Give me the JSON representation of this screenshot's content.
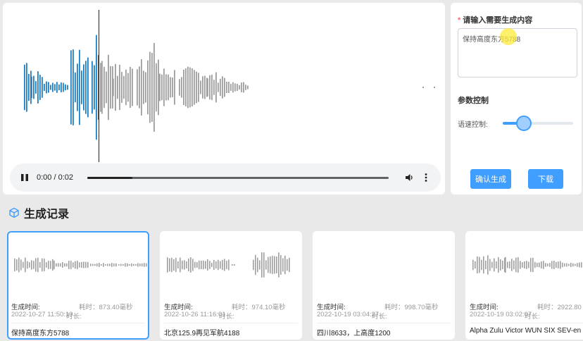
{
  "player": {
    "time": "0:00 / 0:02",
    "progress": 0.15
  },
  "form": {
    "content_label": "请输入需要生成内容",
    "required_mark": "*",
    "content_value": "保持高度东方5788",
    "params_title": "参数控制",
    "speed_label": "语速控制:",
    "speed_value": 0.3,
    "confirm_label": "确认生成",
    "download_label": "下载"
  },
  "history": {
    "title": "生成记录",
    "items": [
      {
        "gen_label": "生成时间:",
        "duration": "耗时：873.40毫秒",
        "time": "2022-10-27 11:50:19",
        "length_label": "时长:",
        "content": "保持高度东方5788",
        "active": true
      },
      {
        "gen_label": "生成时间:",
        "duration": "耗时：974.10毫秒",
        "time": "2022-10-26 11:16:01",
        "length_label": "时长:",
        "content": "北京125.9再见军航4188",
        "active": false
      },
      {
        "gen_label": "生成时间:",
        "duration": "耗时：998.70毫秒",
        "time": "2022-10-19 03:04:27",
        "length_label": "时长:",
        "content": "四川8633，上高度1200",
        "active": false
      },
      {
        "gen_label": "生成时间:",
        "duration": "耗时：2922.80",
        "time": "2022-10-19 03:02:07",
        "length_label": "时长:",
        "content": "Alpha Zulu Victor WUN SIX SEV-en",
        "active": false
      }
    ]
  },
  "colors": {
    "accent": "#409eff",
    "played_wave": "#1f7fc4",
    "unplayed_wave": "#9e9e9e",
    "required": "#f56c6c"
  },
  "icons": {
    "play_pause": "pause-icon",
    "volume": "volume-icon",
    "more": "more-vert-icon",
    "history": "cube-icon"
  }
}
